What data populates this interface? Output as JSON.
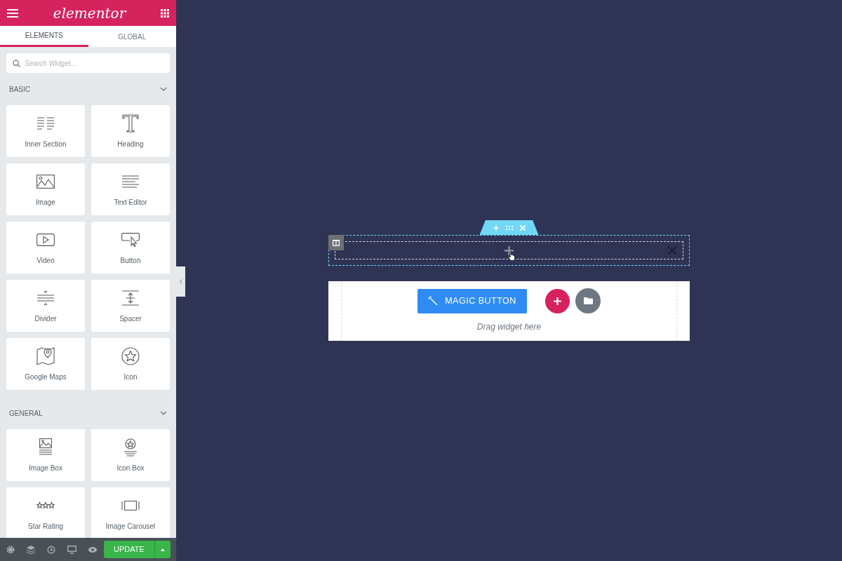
{
  "header": {
    "logo": "elementor"
  },
  "tabs": [
    {
      "label": "ELEMENTS",
      "selected": true
    },
    {
      "label": "GLOBAL",
      "selected": false
    }
  ],
  "search": {
    "placeholder": "Search Widget..."
  },
  "categories": [
    {
      "title": "BASIC",
      "expanded": true,
      "widgets": [
        "Inner Section",
        "Heading",
        "Image",
        "Text Editor",
        "Video",
        "Button",
        "Divider",
        "Spacer",
        "Google Maps",
        "Icon"
      ]
    },
    {
      "title": "GENERAL",
      "expanded": true,
      "widgets": [
        "Image Box",
        "Icon Box",
        "Star Rating",
        "Image Carousel"
      ]
    }
  ],
  "footer": {
    "update_button": "UPDATE"
  },
  "canvas": {
    "magic_button": "MAGIC BUTTON",
    "drop_hint": "Drag widget here"
  }
}
